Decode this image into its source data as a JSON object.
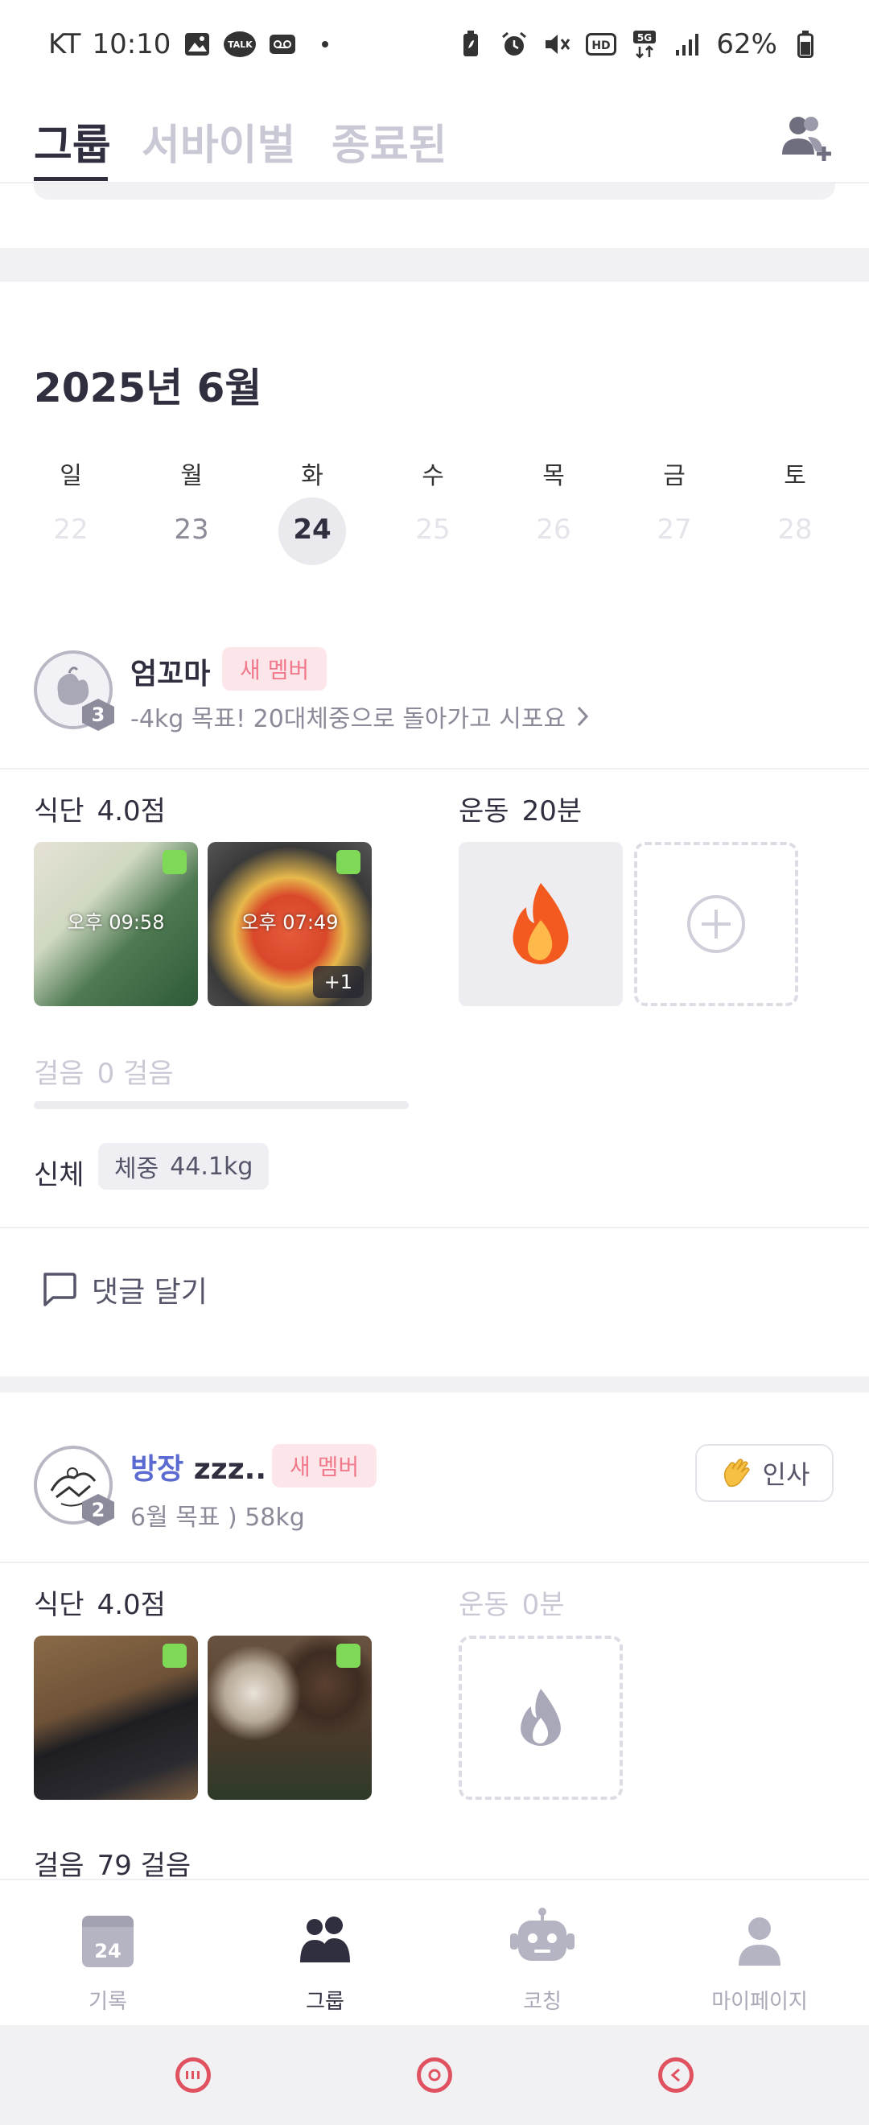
{
  "status_bar": {
    "carrier": "KT",
    "time": "10:10",
    "talk_label": "TALK",
    "hd_label": "HD",
    "network_label": "5G",
    "battery": "62%"
  },
  "tabs": [
    {
      "label": "그룹",
      "active": true
    },
    {
      "label": "서바이벌",
      "active": false
    },
    {
      "label": "종료된",
      "active": false
    }
  ],
  "calendar": {
    "title": "2025년 6월",
    "weekdays": [
      "일",
      "월",
      "화",
      "수",
      "목",
      "금",
      "토"
    ],
    "days": [
      "22",
      "23",
      "24",
      "25",
      "26",
      "27",
      "28"
    ],
    "today": "24"
  },
  "members": [
    {
      "name": "엄꼬마",
      "level": "3",
      "badge": "새 멤버",
      "goal": "-4kg 목표! 20대체중으로 돌아가고 시포요",
      "diet_label": "식단",
      "diet_score": "4.0점",
      "exercise_label": "운동",
      "exercise_value": "20분",
      "photos": [
        {
          "time": "오후 09:58",
          "more": ""
        },
        {
          "time": "오후 07:49",
          "more": "+1"
        }
      ],
      "steps_label": "걸음",
      "steps_value": "0 걸음",
      "steps_progress": 0,
      "body_label": "신체",
      "weight_label": "체중",
      "weight_value": "44.1kg",
      "comment_label": "댓글 달기"
    },
    {
      "name_prefix": "방장",
      "name": "zzz..",
      "level": "2",
      "badge": "새 멤버",
      "goal": "6월 목표 ) 58kg",
      "greet_label": "인사",
      "diet_label": "식단",
      "diet_score": "4.0점",
      "exercise_label": "운동",
      "exercise_value": "0분",
      "steps_label": "걸음",
      "steps_value": "79 걸음"
    }
  ],
  "bottom_nav": {
    "calendar_day": "24",
    "items": [
      {
        "label": "기록",
        "icon": "calendar-icon",
        "active": false
      },
      {
        "label": "그룹",
        "icon": "group-icon",
        "active": true
      },
      {
        "label": "코칭",
        "icon": "robot-icon",
        "active": false
      },
      {
        "label": "마이페이지",
        "icon": "person-icon",
        "active": false
      }
    ]
  },
  "colors": {
    "accent_blue": "#5b6ad0",
    "new_badge_bg": "#fde6ea",
    "new_badge_text": "#f07a8c",
    "check_green": "#7ed957"
  }
}
